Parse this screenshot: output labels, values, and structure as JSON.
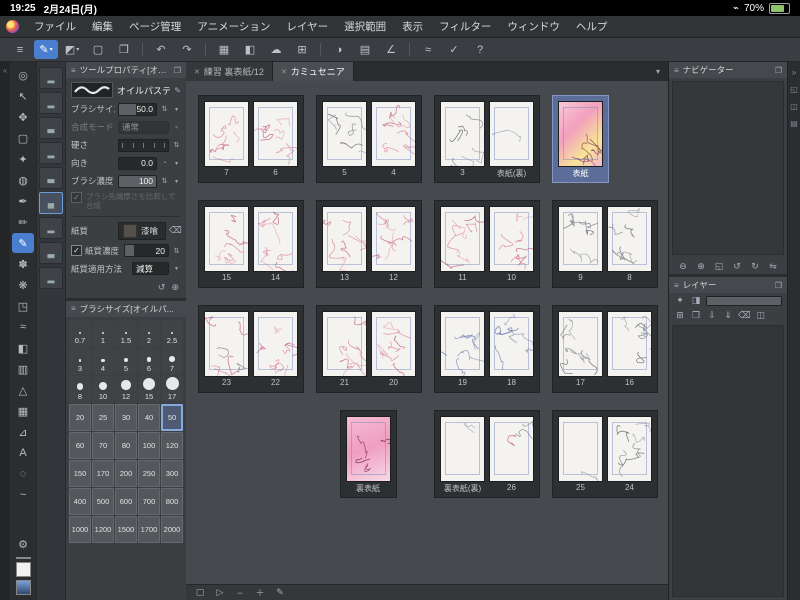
{
  "colors": {
    "accent": "#4a7fd0",
    "selection_blue": "#5d6d99",
    "panel_bg": "#3b3f42",
    "canvas_bg": "#46494d"
  },
  "status_bar": {
    "time": "19:25",
    "date": "2月24日(月)",
    "battery": "70%",
    "side_icon": "⌁"
  },
  "menu_bar": {
    "items": [
      "ファイル",
      "編集",
      "ページ管理",
      "アニメーション",
      "レイヤー",
      "選択範囲",
      "表示",
      "フィルター",
      "ウィンドウ",
      "ヘルプ"
    ]
  },
  "command_bar": {
    "items": [
      {
        "name": "main-menu-icon",
        "glyph": "≡"
      },
      {
        "name": "brush-tool-icon",
        "glyph": "✎",
        "selected": true,
        "dropdown": true
      },
      {
        "name": "color-chip-icon",
        "glyph": "◩",
        "dropdown": true
      },
      {
        "name": "selection-launcher-icon",
        "glyph": "▢"
      },
      {
        "name": "open-file-icon",
        "glyph": "❐"
      },
      {
        "divider": true
      },
      {
        "name": "undo-icon",
        "glyph": "↶"
      },
      {
        "name": "redo-icon",
        "glyph": "↷"
      },
      {
        "divider": true
      },
      {
        "name": "frame-border-icon",
        "glyph": "▦"
      },
      {
        "name": "fill-icon",
        "glyph": "◧"
      },
      {
        "name": "cloud-icon",
        "glyph": "☁"
      },
      {
        "name": "grid-icon",
        "glyph": "⊞"
      },
      {
        "divider": true
      },
      {
        "name": "opacity-icon",
        "glyph": "◑"
      },
      {
        "name": "material-icon",
        "glyph": "▤"
      },
      {
        "name": "snap-icon",
        "glyph": "∠"
      },
      {
        "divider": true
      },
      {
        "name": "smoothing-icon",
        "glyph": "≈"
      },
      {
        "name": "correction-icon",
        "glyph": "✓"
      },
      {
        "name": "help-icon",
        "glyph": "?"
      }
    ]
  },
  "tool_strip": {
    "tools": [
      {
        "name": "zoom-tool-icon",
        "glyph": "◎"
      },
      {
        "name": "operation-tool-icon",
        "glyph": "↖"
      },
      {
        "name": "move-tool-icon",
        "glyph": "✥"
      },
      {
        "name": "selection-tool-icon",
        "glyph": "▢"
      },
      {
        "name": "auto-select-tool-icon",
        "glyph": "✦"
      },
      {
        "name": "eyedropper-tool-icon",
        "glyph": "◍"
      },
      {
        "name": "pen-tool-icon",
        "glyph": "✒"
      },
      {
        "name": "pencil-tool-icon",
        "glyph": "✏"
      },
      {
        "name": "brush-tool-icon",
        "glyph": "✎",
        "selected": true
      },
      {
        "name": "airbrush-tool-icon",
        "glyph": "✽"
      },
      {
        "name": "decoration-tool-icon",
        "glyph": "❋"
      },
      {
        "name": "eraser-tool-icon",
        "glyph": "◳"
      },
      {
        "name": "blend-tool-icon",
        "glyph": "≈"
      },
      {
        "name": "fill-tool-icon",
        "glyph": "◧"
      },
      {
        "name": "gradient-tool-icon",
        "glyph": "▥"
      },
      {
        "name": "figure-tool-icon",
        "glyph": "△"
      },
      {
        "name": "frame-tool-icon",
        "glyph": "▦"
      },
      {
        "name": "ruler-tool-icon",
        "glyph": "⊿"
      },
      {
        "name": "text-tool-icon",
        "glyph": "A"
      },
      {
        "name": "balloon-tool-icon",
        "glyph": "◌"
      },
      {
        "name": "correct-line-tool-icon",
        "glyph": "~"
      }
    ]
  },
  "subtool_strip": {
    "tiles": [
      {
        "name": "subtool-tile",
        "glyph": "▂"
      },
      {
        "name": "subtool-tile",
        "glyph": "▂"
      },
      {
        "name": "subtool-tile",
        "glyph": "▃"
      },
      {
        "name": "subtool-tile",
        "glyph": "▂"
      },
      {
        "name": "subtool-tile",
        "glyph": "▃"
      },
      {
        "name": "subtool-tile",
        "glyph": "▄",
        "selected": true
      },
      {
        "name": "subtool-tile",
        "glyph": "▂"
      },
      {
        "name": "subtool-tile",
        "glyph": "▃"
      },
      {
        "name": "subtool-tile",
        "glyph": "▂"
      }
    ]
  },
  "tool_property": {
    "title": "ツールプロパティ[オイル...]",
    "subtool": "オイルパステル",
    "brush_size_label": "ブラシサイズ",
    "brush_size_value": "50.0",
    "blend_label": "合成モード",
    "blend_value": "通常",
    "hardness_label": "硬さ",
    "direction_label": "向き",
    "direction_value": "0.0",
    "density_label": "ブラシ濃度",
    "density_value": "100",
    "tip_checkbox": "ブラシ先端厚さを比較して合成",
    "texture_label": "紙質",
    "texture_value": "漆喰",
    "texture_density_label": "紙質濃度",
    "texture_density_value": "20",
    "texture_apply_label": "紙質適用方法",
    "texture_apply_value": "減算",
    "check_glyph": "✓"
  },
  "brush_size_panel": {
    "title": "ブラシサイズ[オイルパ...",
    "selected": "50",
    "sizes": [
      "0.7",
      "1",
      "1.5",
      "2",
      "2.5",
      "3",
      "4",
      "5",
      "6",
      "7",
      "8",
      "10",
      "12",
      "15",
      "17",
      "20",
      "25",
      "30",
      "40",
      "50",
      "60",
      "70",
      "80",
      "100",
      "120",
      "150",
      "170",
      "200",
      "250",
      "300",
      "400",
      "500",
      "600",
      "700",
      "800",
      "1000",
      "1200",
      "1500",
      "1700",
      "2000"
    ]
  },
  "tabs": [
    {
      "label": "練習 裏表紙/12",
      "active": false
    },
    {
      "label": "カミュセニア",
      "active": true
    }
  ],
  "page_manager": {
    "rows": [
      [
        {
          "pages": [
            {
              "label": "7",
              "v": "pink"
            },
            {
              "label": "6",
              "v": "pink"
            }
          ]
        },
        {
          "pages": [
            {
              "label": "5",
              "v": "gray"
            },
            {
              "label": "4",
              "v": "pink"
            }
          ]
        },
        {
          "pages": [
            {
              "label": "3",
              "v": "gray"
            },
            {
              "label": "表紙(裏)",
              "v": "blank"
            }
          ]
        },
        {
          "pages": [
            {
              "label": "表紙",
              "v": "cover"
            }
          ],
          "selected": true,
          "align": "left"
        }
      ],
      [
        {
          "pages": [
            {
              "label": "15",
              "v": "pink"
            },
            {
              "label": "14",
              "v": "pink"
            }
          ]
        },
        {
          "pages": [
            {
              "label": "13",
              "v": "pink"
            },
            {
              "label": "12",
              "v": "pink"
            }
          ]
        },
        {
          "pages": [
            {
              "label": "11",
              "v": "pink"
            },
            {
              "label": "10",
              "v": "pink"
            }
          ]
        },
        {
          "pages": [
            {
              "label": "9",
              "v": "gray"
            },
            {
              "label": "8",
              "v": "gray"
            }
          ]
        }
      ],
      [
        {
          "pages": [
            {
              "label": "23",
              "v": "mixed"
            },
            {
              "label": "22",
              "v": "pink"
            }
          ]
        },
        {
          "pages": [
            {
              "label": "21",
              "v": "pink"
            },
            {
              "label": "20",
              "v": "pink"
            }
          ]
        },
        {
          "pages": [
            {
              "label": "19",
              "v": "blue"
            },
            {
              "label": "18",
              "v": "blue"
            }
          ]
        },
        {
          "pages": [
            {
              "label": "17",
              "v": "gray"
            },
            {
              "label": "16",
              "v": "gray"
            }
          ]
        }
      ],
      [
        {
          "spacer": true
        },
        {
          "pages": [
            {
              "label": "裏表紙",
              "v": "backcover"
            }
          ],
          "align": "center"
        },
        {
          "pages": [
            {
              "label": "裏表紙(裏)",
              "v": "blank"
            },
            {
              "label": "26",
              "v": "light"
            }
          ]
        },
        {
          "pages": [
            {
              "label": "25",
              "v": "blank"
            },
            {
              "label": "24",
              "v": "gray"
            }
          ]
        }
      ]
    ]
  },
  "bottom_bar": {
    "items": [
      {
        "name": "canvas-view-icon",
        "glyph": "▢"
      },
      {
        "name": "play-icon",
        "glyph": "▷"
      },
      {
        "name": "zoom-out-icon",
        "glyph": "−"
      },
      {
        "name": "zoom-in-icon",
        "glyph": "＋"
      },
      {
        "name": "edit-mode-icon",
        "glyph": "✎"
      }
    ]
  },
  "navigator": {
    "title": "ナビゲーター",
    "controls": [
      {
        "name": "zoom-out-icon",
        "glyph": "⊖"
      },
      {
        "name": "zoom-in-icon",
        "glyph": "⊕"
      },
      {
        "name": "fit-icon",
        "glyph": "◱"
      },
      {
        "name": "rotate-left-icon",
        "glyph": "↺"
      },
      {
        "name": "rotate-right-icon",
        "glyph": "↻"
      },
      {
        "name": "flip-icon",
        "glyph": "⇋"
      }
    ]
  },
  "layer_panel": {
    "title": "レイヤー",
    "row1": [
      {
        "name": "effect-icon",
        "glyph": "✦"
      },
      {
        "name": "blend-mode-icon",
        "glyph": "◨"
      }
    ],
    "row2": [
      {
        "name": "new-layer-icon",
        "glyph": "⊞"
      },
      {
        "name": "new-folder-icon",
        "glyph": "❐"
      },
      {
        "name": "transfer-down-icon",
        "glyph": "⇩"
      },
      {
        "name": "merge-down-icon",
        "glyph": "⇓"
      },
      {
        "name": "delete-layer-icon",
        "glyph": "⌫"
      },
      {
        "name": "mask-icon",
        "glyph": "◫"
      }
    ]
  },
  "edge_left": {
    "items": [
      {
        "name": "hide-toolbar-icon",
        "glyph": "«"
      }
    ]
  },
  "edge_right": {
    "items": [
      {
        "name": "collapse-panels-icon",
        "glyph": "»"
      },
      {
        "name": "navigator-panel-icon",
        "glyph": "◱"
      },
      {
        "name": "layer-panel-icon",
        "glyph": "◫"
      },
      {
        "name": "material-panel-icon",
        "glyph": "▤"
      }
    ]
  }
}
